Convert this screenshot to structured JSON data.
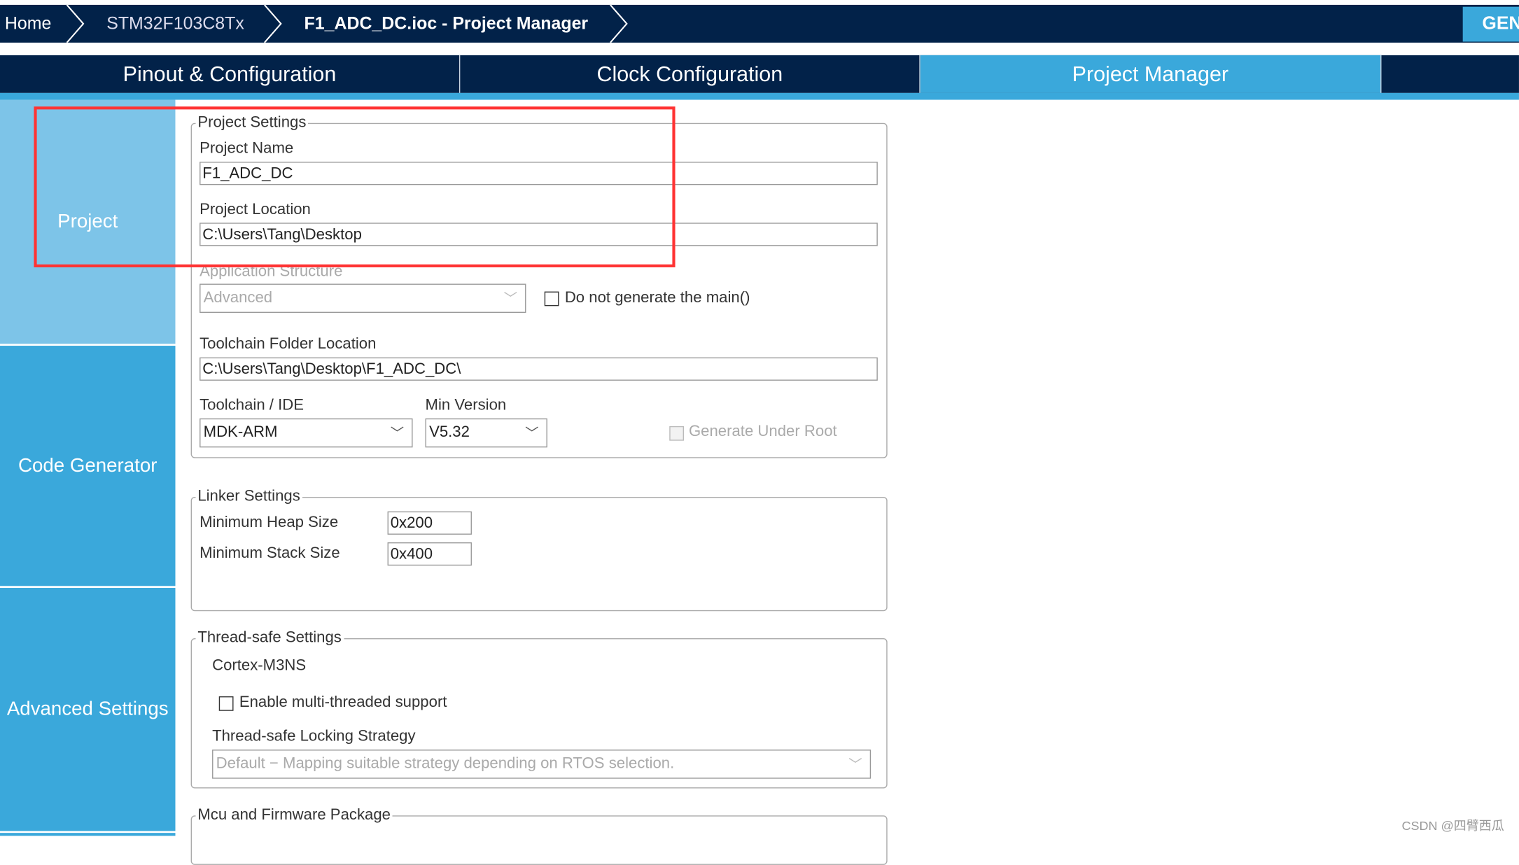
{
  "breadcrumb": {
    "items": [
      "Home",
      "STM32F103C8Tx",
      "F1_ADC_DC.ioc - Project Manager"
    ],
    "generate_button": "GEN"
  },
  "tabs": [
    {
      "label": "Pinout & Configuration"
    },
    {
      "label": "Clock Configuration"
    },
    {
      "label": "Project Manager",
      "active": true
    }
  ],
  "sidebar": {
    "items": [
      {
        "label": "Project",
        "active": true
      },
      {
        "label": "Code Generator"
      },
      {
        "label": "Advanced Settings"
      }
    ]
  },
  "project_settings": {
    "legend": "Project Settings",
    "project_name_label": "Project Name",
    "project_name": "F1_ADC_DC",
    "project_location_label": "Project Location",
    "project_location": "C:\\Users\\Tang\\Desktop",
    "app_structure_label": "Application Structure",
    "app_structure": "Advanced",
    "no_main_label": "Do not generate the main()",
    "no_main_checked": false,
    "toolchain_folder_label": "Toolchain Folder Location",
    "toolchain_folder": "C:\\Users\\Tang\\Desktop\\F1_ADC_DC\\",
    "toolchain_label": "Toolchain / IDE",
    "toolchain": "MDK-ARM",
    "min_version_label": "Min Version",
    "min_version": "V5.32",
    "gen_under_root_label": "Generate Under Root",
    "gen_under_root_checked": false
  },
  "linker_settings": {
    "legend": "Linker Settings",
    "heap_label": "Minimum Heap Size",
    "heap": "0x200",
    "stack_label": "Minimum Stack Size",
    "stack": "0x400"
  },
  "thread_safe": {
    "legend": "Thread-safe Settings",
    "core": "Cortex-M3NS",
    "multi_thread_label": "Enable multi-threaded support",
    "multi_thread_checked": false,
    "strategy_label": "Thread-safe Locking Strategy",
    "strategy": "Default  −  Mapping suitable strategy depending on RTOS selection."
  },
  "mcu_firmware": {
    "legend": "Mcu and Firmware Package"
  },
  "watermark": "CSDN @四臂西瓜",
  "colors": {
    "dark": "#022249",
    "accent": "#3aa8db",
    "sidebar_active": "#7dc4e8",
    "highlight": "#ff3333"
  }
}
